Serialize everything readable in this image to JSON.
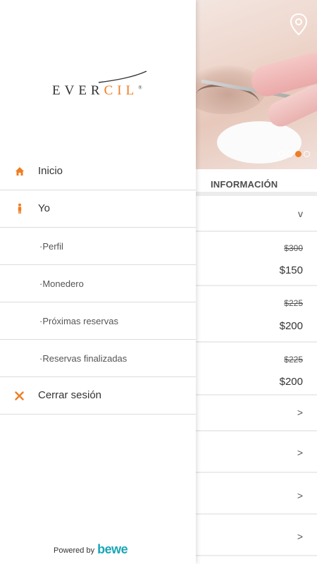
{
  "colors": {
    "accent": "#ef7d22",
    "brand_bewe": "#1aa6b7",
    "divider": "#dcdcdc"
  },
  "background": {
    "section_title": "INFORMACIÓN",
    "carousel": {
      "total_slides": 4,
      "active_index": 2
    },
    "rows": [
      {
        "type": "expand",
        "chevron": "v"
      },
      {
        "type": "price",
        "old_price": "$300",
        "new_price": "$150"
      },
      {
        "type": "price",
        "old_price": "$225",
        "new_price": "$200"
      },
      {
        "type": "price",
        "old_price": "$225",
        "new_price": "$200"
      },
      {
        "type": "link",
        "chevron": ">"
      },
      {
        "type": "link",
        "chevron": ">"
      },
      {
        "type": "link",
        "chevron": ">"
      },
      {
        "type": "link",
        "chevron": ">"
      }
    ],
    "icons": [
      "location-pin-icon"
    ]
  },
  "drawer": {
    "logo": {
      "text_main": "EVER",
      "text_accent": "CIL",
      "mark": "®"
    },
    "menu": [
      {
        "label": "Inicio",
        "icon": "home-icon"
      },
      {
        "label": "Yo",
        "icon": "person-icon"
      },
      {
        "label": "·Perfil"
      },
      {
        "label": "·Monedero"
      },
      {
        "label": "·Próximas reservas"
      },
      {
        "label": "·Reservas finalizadas"
      },
      {
        "label": "Cerrar sesión",
        "icon": "close-icon"
      }
    ],
    "footer": {
      "powered_by": "Powered by",
      "brand": "bewe"
    }
  }
}
